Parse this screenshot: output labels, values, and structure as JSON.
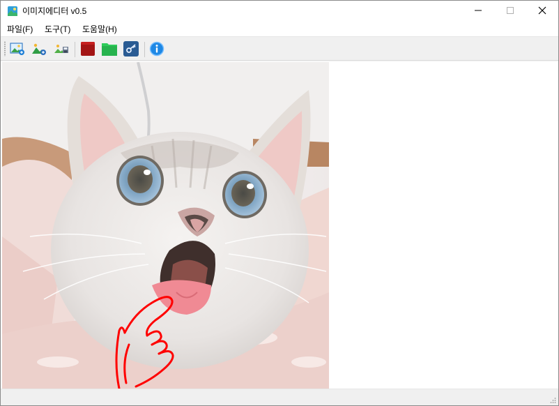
{
  "window": {
    "title": "이미지에디터 v0.5",
    "app_icon": "image-editor-app-icon",
    "controls": {
      "minimize_icon": "minimize-icon",
      "maximize_icon": "maximize-icon",
      "close_icon": "close-icon"
    }
  },
  "menubar": {
    "items": [
      {
        "label": "파일(F)"
      },
      {
        "label": "도구(T)"
      },
      {
        "label": "도움말(H)"
      }
    ]
  },
  "toolbar": {
    "buttons": [
      {
        "icon": "open-image-icon"
      },
      {
        "icon": "add-image-icon"
      },
      {
        "icon": "save-image-icon"
      },
      {
        "icon": "red-color-icon",
        "color": "#a31515"
      },
      {
        "icon": "green-color-icon",
        "color": "#2ecc5a"
      },
      {
        "icon": "key-icon"
      },
      {
        "icon": "info-icon",
        "color": "#1e88e5"
      }
    ]
  },
  "canvas": {
    "image": "cat-photo",
    "drawing_color": "#ff0000"
  },
  "colors": {
    "title_bar_bg": "#ffffff",
    "window_bg": "#f0f0f0",
    "canvas_bg": "#ffffff"
  }
}
